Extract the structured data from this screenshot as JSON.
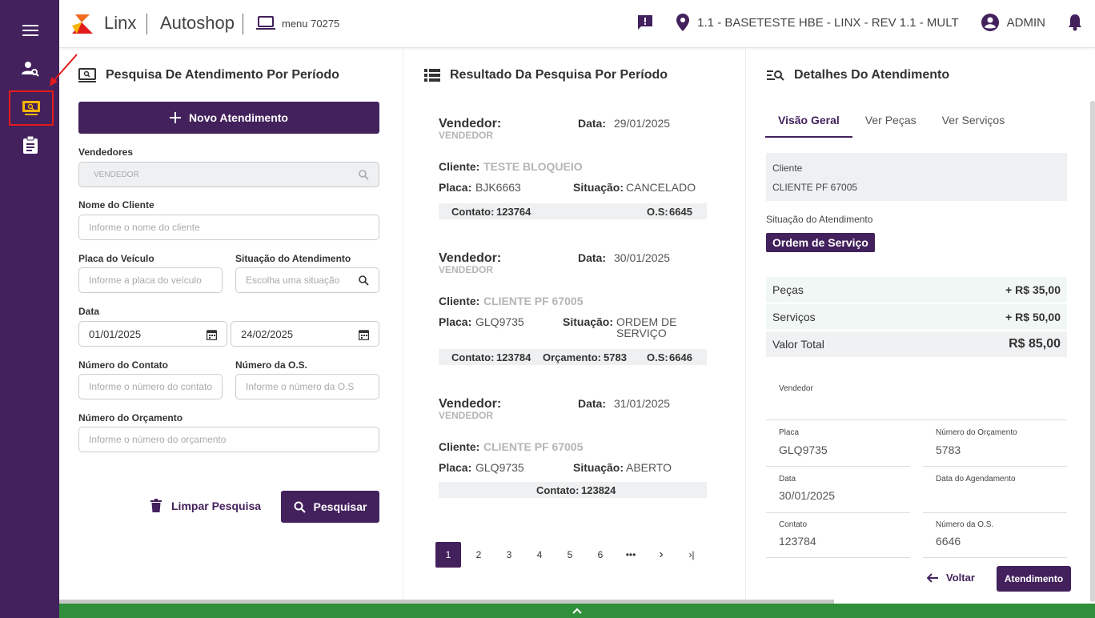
{
  "header": {
    "brand": "Linx",
    "product": "Autoshop",
    "menu": "menu 70275",
    "location": "1.1 - BASETESTE HBE - LINX - REV 1.1 - MULT",
    "user": "ADMIN"
  },
  "colors": {
    "primary": "#43215c",
    "sidebar": "#43215c",
    "footer": "#2f8f3a",
    "highlight": "#e21b1b",
    "active_icon": "#f5b400"
  },
  "search": {
    "title": "Pesquisa De Atendimento Por Período",
    "new_button": "Novo Atendimento",
    "vendedores_label": "Vendedores",
    "vendedores_value": "VENDEDOR",
    "cliente_label": "Nome do Cliente",
    "cliente_placeholder": "Informe o nome do cliente",
    "placa_label": "Placa do Veículo",
    "placa_placeholder": "Informe a placa do veículo",
    "situacao_label": "Situação do Atendimento",
    "situacao_placeholder": "Escolha uma situação",
    "data_label": "Data",
    "data_inicio": "01/01/2025",
    "data_fim": "24/02/2025",
    "contato_label": "Número do Contato",
    "contato_placeholder": "Informe o número do contato",
    "os_label": "Número da O.S.",
    "os_placeholder": "Informe o número da O.S",
    "orcamento_label": "Número do Orçamento",
    "orcamento_placeholder": "Informe o número do orçamento",
    "clear_button": "Limpar Pesquisa",
    "search_button": "Pesquisar"
  },
  "results": {
    "title": "Resultado Da Pesquisa Por Período",
    "labels": {
      "vendedor": "Vendedor:",
      "data": "Data:",
      "cliente": "Cliente:",
      "placa": "Placa:",
      "situacao": "Situação:",
      "contato": "Contato:",
      "orcamento": "Orçamento:",
      "os": "O.S:"
    },
    "items": [
      {
        "vendedor": "VENDEDOR",
        "data": "29/01/2025",
        "cliente": "TESTE BLOQUEIO",
        "placa": "BJK6663",
        "situacao": "CANCELADO",
        "contato": "123764",
        "os": "6645"
      },
      {
        "vendedor": "VENDEDOR",
        "data": "30/01/2025",
        "cliente": "CLIENTE PF 67005",
        "placa": "GLQ9735",
        "situacao_1": "ORDEM DE",
        "situacao_2": "SERVIÇO",
        "contato": "123784",
        "orcamento": "5783",
        "os": "6646"
      },
      {
        "vendedor": "VENDEDOR",
        "data": "31/01/2025",
        "cliente": "CLIENTE PF 67005",
        "placa": "GLQ9735",
        "situacao": "ABERTO",
        "contato": "123824"
      }
    ],
    "pages": [
      "1",
      "2",
      "3",
      "4",
      "5",
      "6",
      "•••",
      "›",
      "›|"
    ]
  },
  "details": {
    "title": "Detalhes Do Atendimento",
    "tabs": [
      "Visão Geral",
      "Ver Peças",
      "Ver Serviços"
    ],
    "cliente_label": "Cliente",
    "cliente_value": "CLIENTE PF 67005",
    "situacao_label": "Situação do Atendimento",
    "situacao_value": "Ordem de Serviço",
    "pecas_label": "Peças",
    "pecas_value": "+ R$ 35,00",
    "servicos_label": "Serviços",
    "servicos_value": "+ R$ 50,00",
    "total_label": "Valor Total",
    "total_value": "R$ 85,00",
    "vendedor_label": "Vendedor",
    "placa_label": "Placa",
    "placa_value": "GLQ9735",
    "orcamento_label": "Número do Orçamento",
    "orcamento_value": "5783",
    "data_label": "Data",
    "data_value": "30/01/2025",
    "agendamento_label": "Data do Agendamento",
    "contato_label": "Contato",
    "contato_value": "123784",
    "os_label": "Número da O.S.",
    "os_value": "6646",
    "back_button": "Voltar",
    "atendimento_button": "Atendimento"
  }
}
